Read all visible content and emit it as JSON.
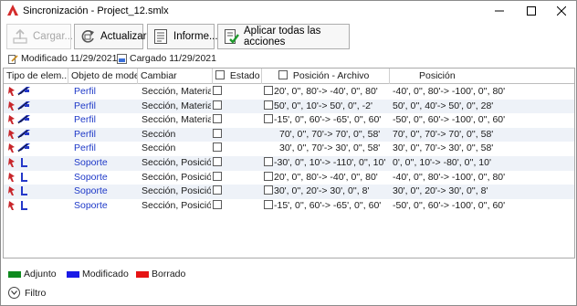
{
  "window": {
    "title": "Sincronización - Project_12.smlx",
    "controls": [
      "minimize",
      "maximize",
      "close"
    ]
  },
  "toolbar": {
    "load_label": "Cargar...",
    "update_label": "Actualizar",
    "report_label": "Informe...",
    "apply_all_label": "Aplicar todas las acciones"
  },
  "status": {
    "modified": "Modificado 11/29/2021",
    "loaded": "Cargado 11/29/2021"
  },
  "grid": {
    "headers": {
      "type": "Tipo de elem...",
      "model_object": "Objeto de modelo",
      "change": "Cambiar",
      "state": "Estado",
      "position_file": "Posición - Archivo",
      "position": "Posición"
    },
    "rows": [
      {
        "kind": "profile",
        "object": "Perfil",
        "change": "Sección, Material",
        "file_checkbox": true,
        "file_pos": "20', 0'', 80'-> -40', 0'', 80'",
        "position": "-40', 0'', 80'-> -100', 0'', 80'"
      },
      {
        "kind": "profile",
        "object": "Perfil",
        "change": "Sección, Material",
        "file_checkbox": true,
        "file_pos": "50', 0'', 10'-> 50', 0'', -2'",
        "position": "50', 0'', 40'-> 50', 0'', 28'"
      },
      {
        "kind": "profile",
        "object": "Perfil",
        "change": "Sección, Material",
        "file_checkbox": true,
        "file_pos": "-15', 0'', 60'-> -65', 0'', 60'",
        "position": "-50', 0'', 60'-> -100', 0'', 60'"
      },
      {
        "kind": "profile",
        "object": "Perfil",
        "change": "Sección",
        "file_checkbox": false,
        "file_pos": "70', 0'', 70'-> 70', 0'', 58'",
        "position": "70', 0'', 70'-> 70', 0'', 58'"
      },
      {
        "kind": "profile",
        "object": "Perfil",
        "change": "Sección",
        "file_checkbox": false,
        "file_pos": "30', 0'', 70'-> 30', 0'', 58'",
        "position": "30', 0'', 70'-> 30', 0'', 58'"
      },
      {
        "kind": "support",
        "object": "Soporte",
        "change": "Sección, Posición",
        "file_checkbox": true,
        "file_pos": "-30', 0'', 10'-> -110', 0'', 10'",
        "position": "0', 0'', 10'-> -80', 0'', 10'"
      },
      {
        "kind": "support",
        "object": "Soporte",
        "change": "Sección, Posición",
        "file_checkbox": true,
        "file_pos": "20', 0'', 80'-> -40', 0'', 80'",
        "position": "-40', 0'', 80'-> -100', 0'', 80'"
      },
      {
        "kind": "support",
        "object": "Soporte",
        "change": "Sección, Posición",
        "file_checkbox": true,
        "file_pos": "30', 0'', 20'-> 30', 0'', 8'",
        "position": "30', 0'', 20'-> 30', 0'', 8'"
      },
      {
        "kind": "support",
        "object": "Soporte",
        "change": "Sección, Posición",
        "file_checkbox": true,
        "file_pos": "-15', 0'', 60'-> -65', 0'', 60'",
        "position": "-50', 0'', 60'-> -100', 0'', 60'"
      }
    ]
  },
  "legend": [
    {
      "label": "Adjunto",
      "color": "#0f8a1f"
    },
    {
      "label": "Modificado",
      "color": "#1a1ae6"
    },
    {
      "label": "Borrado",
      "color": "#e61414"
    }
  ],
  "filter": {
    "label": "Filtro"
  },
  "colors": {
    "link": "#1e39c8",
    "alt_row": "#eef2f8",
    "app_icon": "#d42b2b"
  }
}
